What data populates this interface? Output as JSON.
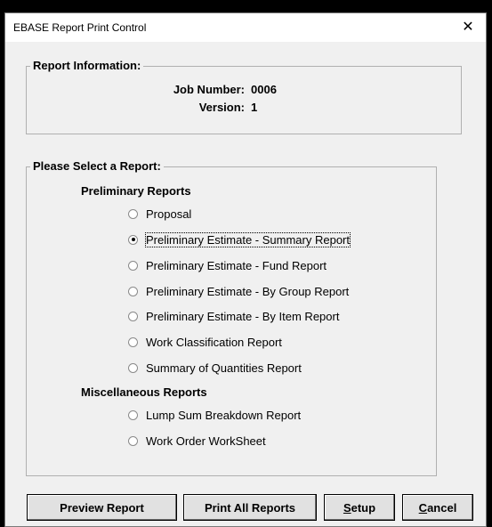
{
  "window": {
    "title": "EBASE Report Print Control",
    "close_glyph": "✕"
  },
  "report_info": {
    "legend": "Report Information:",
    "job_number_label": "Job Number:",
    "job_number": "0006",
    "version_label": "Version:",
    "version": "1"
  },
  "report_select": {
    "legend": "Please Select a Report:",
    "preliminary_heading": "Preliminary Reports",
    "preliminary_options": [
      {
        "label": "Proposal",
        "checked": false
      },
      {
        "label": "Preliminary Estimate - Summary Report",
        "checked": true
      },
      {
        "label": "Preliminary Estimate - Fund Report",
        "checked": false
      },
      {
        "label": "Preliminary Estimate - By Group Report",
        "checked": false
      },
      {
        "label": "Preliminary Estimate - By Item Report",
        "checked": false
      },
      {
        "label": "Work Classification Report",
        "checked": false
      },
      {
        "label": "Summary of Quantities Report",
        "checked": false
      }
    ],
    "misc_heading": "Miscellaneous Reports",
    "misc_options": [
      {
        "label": "Lump Sum Breakdown Report",
        "checked": false
      },
      {
        "label": "Work Order WorkSheet",
        "checked": false
      }
    ]
  },
  "buttons": {
    "preview": "Preview Report",
    "print_all": "Print All Reports",
    "setup_mnemonic": "S",
    "setup_rest": "etup",
    "cancel_mnemonic": "C",
    "cancel_rest": "ancel"
  }
}
